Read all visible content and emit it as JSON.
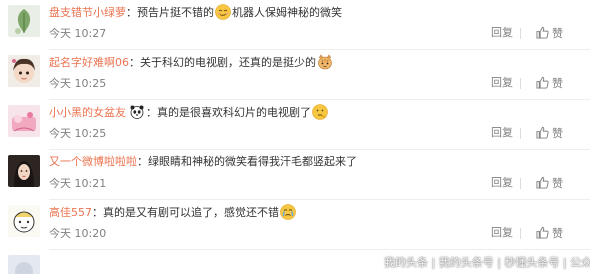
{
  "actions": {
    "reply_label": "回复",
    "like_label": "赞"
  },
  "comments": [
    {
      "user": "盘支错节小绿萝",
      "text_before": "预告片挺不错的",
      "text_after": "机器人保姆神秘的微笑",
      "time": "今天 10:27",
      "emoji": "smirk-emoji"
    },
    {
      "user": "起名字好难啊06",
      "text_before": "关于科幻的电视剧，还真的是挺少的",
      "text_after": "",
      "time": "今天 10:25",
      "emoji": "cat-face-emoji"
    },
    {
      "user": "小小黑的女盆友",
      "text_before": "真的是很喜欢科幻片的电视剧了",
      "text_after": "",
      "time": "今天 10:25",
      "emoji": "thinking-emoji"
    },
    {
      "user": "又一个微博啦啦啦",
      "text_before": "绿眼睛和神秘的微笑看得我汗毛都竖起来了",
      "text_after": "",
      "time": "今天 10:21",
      "emoji": ""
    },
    {
      "user": "高佳557",
      "text_before": "真的是又有剧可以追了，感觉还不错",
      "text_after": "",
      "time": "今天 10:20",
      "emoji": "crying-emoji"
    }
  ],
  "watermark": "我的头条 | 我的头条号 | 秒懂头条号 | 公众号"
}
